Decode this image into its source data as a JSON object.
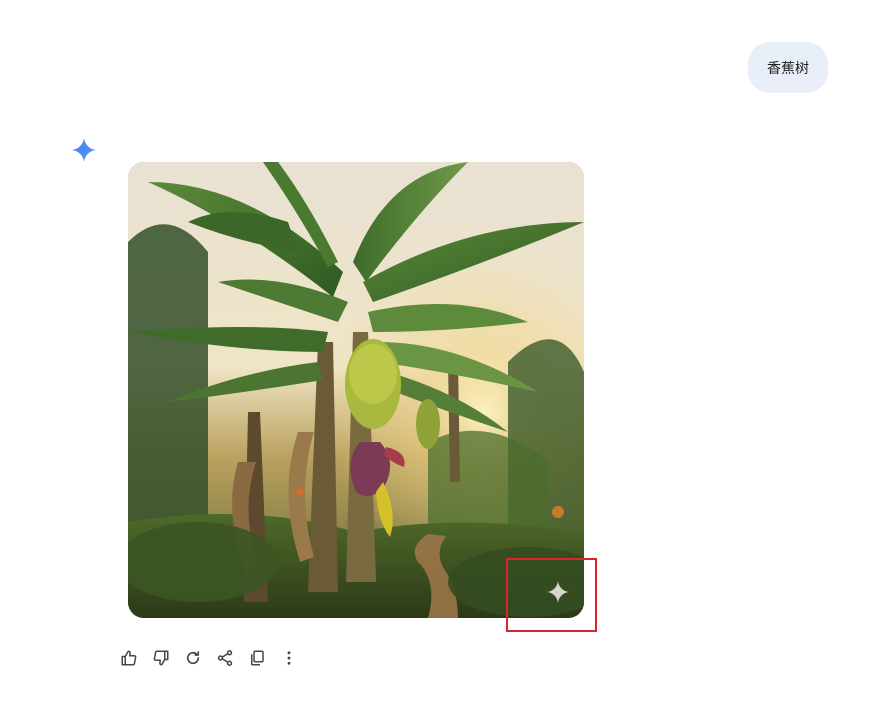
{
  "conversation": {
    "user_prompt": "香蕉树"
  },
  "response": {
    "image": {
      "subject": "banana-tree",
      "watermark_icon": "sparkle-icon"
    },
    "highlight_color": "#d9262c",
    "model_icon": "gemini-sparkle-icon",
    "model_icon_color": "#4285f4"
  },
  "actions": [
    {
      "name": "thumbs-up-icon"
    },
    {
      "name": "thumbs-down-icon"
    },
    {
      "name": "regenerate-icon"
    },
    {
      "name": "share-icon"
    },
    {
      "name": "copy-icon"
    },
    {
      "name": "more-options-icon"
    }
  ]
}
